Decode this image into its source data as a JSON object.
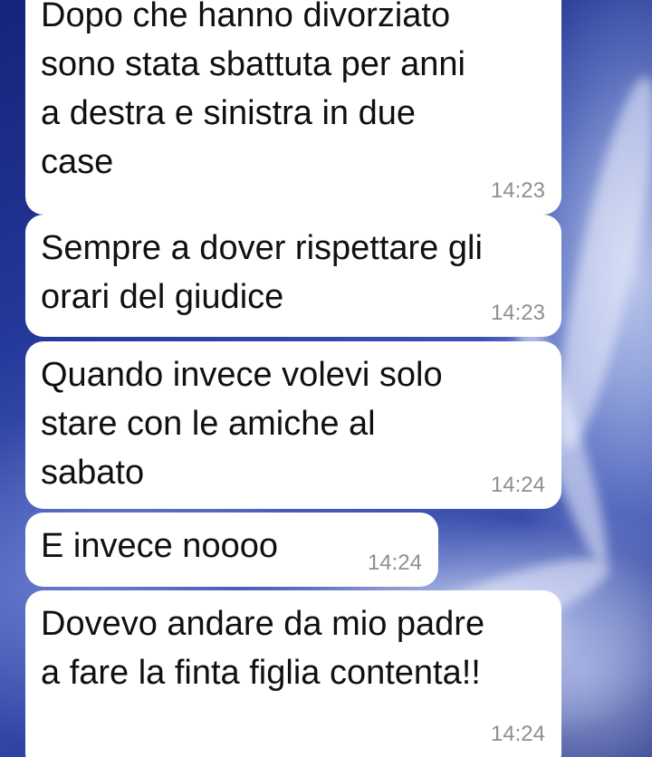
{
  "chat": {
    "messages": [
      {
        "text": "Dopo che hanno divorziato\nsono stata sbattuta per anni\na destra e sinistra in due\ncase",
        "time": "14:23"
      },
      {
        "text": "Sempre a dover rispettare gli\norari del giudice",
        "time": "14:23"
      },
      {
        "text": "Quando invece volevi solo\nstare con le amiche al\nsabato",
        "time": "14:24"
      },
      {
        "text": "E invece noooo",
        "time": "14:24"
      },
      {
        "text": "Dovevo andare da mio padre\na fare la finta figlia contenta!!",
        "time": "14:24"
      }
    ]
  }
}
